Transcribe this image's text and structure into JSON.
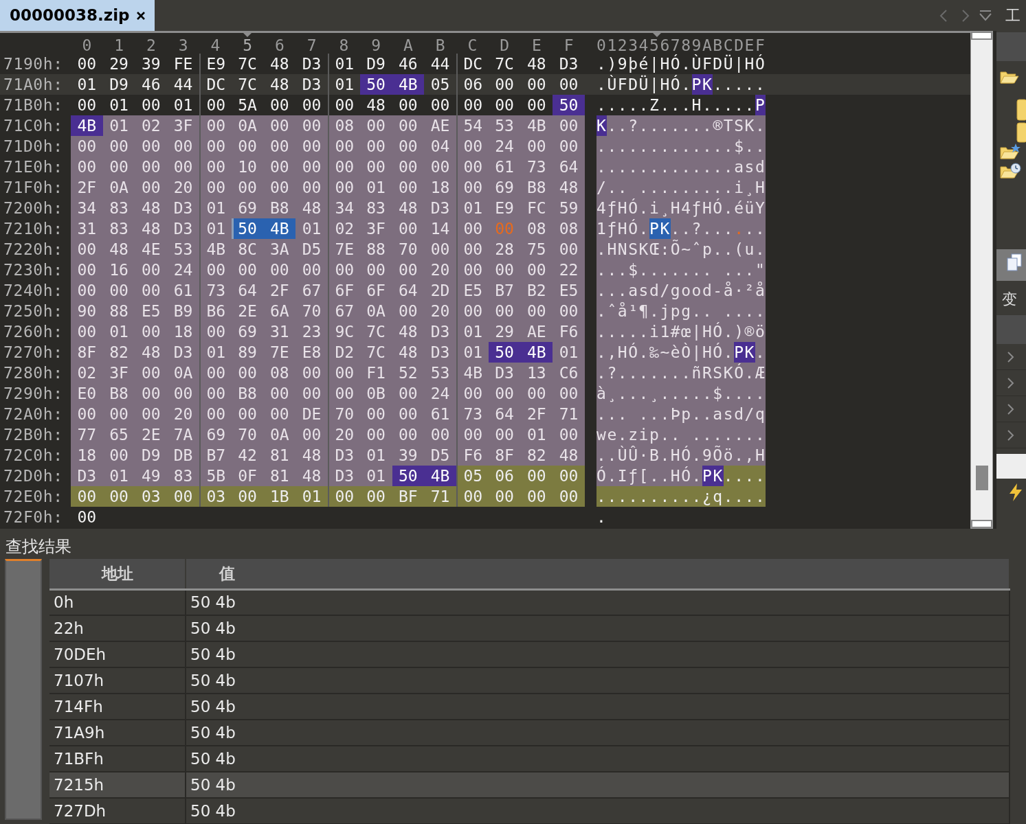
{
  "tabs": [
    {
      "label": "00000038.zip",
      "selected": true
    }
  ],
  "right_panel": {
    "title": "工",
    "section": "变"
  },
  "hex_view": {
    "columns": [
      {
        "label": "0",
        "selected": false
      },
      {
        "label": "1",
        "selected": false
      },
      {
        "label": "2",
        "selected": false
      },
      {
        "label": "3",
        "selected": false
      },
      {
        "label": "4",
        "selected": false
      },
      {
        "label": "5",
        "selected": true
      },
      {
        "label": "6",
        "selected": false
      },
      {
        "label": "7",
        "selected": false
      },
      {
        "label": "8",
        "selected": false
      },
      {
        "label": "9",
        "selected": false
      },
      {
        "label": "A",
        "selected": false
      },
      {
        "label": "B",
        "selected": false
      },
      {
        "label": "C",
        "selected": false
      },
      {
        "label": "D",
        "selected": false
      },
      {
        "label": "E",
        "selected": false
      },
      {
        "label": "F",
        "selected": false
      }
    ],
    "ascii_header": "0123456789ABCDEF",
    "rows": [
      {
        "offset": "7190h:",
        "highlighted": false,
        "hex": [
          {
            "kind": "plain",
            "bytes": [
              "00",
              "29",
              "39",
              "FE",
              "E9",
              "7C",
              "48",
              "D3",
              "01",
              "D9",
              "46",
              "44",
              "DC",
              "7C",
              "48",
              "D3"
            ]
          }
        ],
        "ascii": [
          {
            "kind": "plain",
            "text": ".)9þé|HÓ.ÙFDÜ|HÓ"
          }
        ]
      },
      {
        "offset": "71A0h:",
        "highlighted": true,
        "hex": [
          {
            "kind": "plain",
            "bytes": [
              "01",
              "D9",
              "46",
              "44",
              "DC",
              "7C",
              "48",
              "D3",
              "01"
            ]
          },
          {
            "kind": "match",
            "bytes": [
              "50",
              "4B"
            ]
          },
          {
            "kind": "plain",
            "bytes": [
              "05",
              "06",
              "00",
              "00",
              "00"
            ]
          }
        ],
        "ascii": [
          {
            "kind": "plain",
            "text": ".ÙFDÜ|HÓ."
          },
          {
            "kind": "match",
            "text": "PK"
          },
          {
            "kind": "plain",
            "text": "....."
          }
        ]
      },
      {
        "offset": "71B0h:",
        "highlighted": false,
        "hex": [
          {
            "kind": "plain",
            "bytes": [
              "00",
              "01",
              "00",
              "01",
              "00",
              "5A",
              "00",
              "00",
              "00",
              "48",
              "00",
              "00",
              "00",
              "00",
              "00"
            ]
          },
          {
            "kind": "match",
            "bytes": [
              "50"
            ]
          }
        ],
        "ascii": [
          {
            "kind": "plain",
            "text": ".....Z...H....."
          },
          {
            "kind": "match",
            "text": "P"
          }
        ]
      },
      {
        "offset": "71C0h:",
        "highlighted": false,
        "hex": [
          {
            "kind": "match",
            "bytes": [
              "4B"
            ]
          },
          {
            "kind": "region",
            "bytes": [
              "01",
              "02",
              "3F",
              "00",
              "0A",
              "00",
              "00",
              "08",
              "00",
              "00",
              "AE",
              "54",
              "53",
              "4B",
              "00"
            ]
          }
        ],
        "ascii": [
          {
            "kind": "match",
            "text": "K"
          },
          {
            "kind": "region",
            "text": "..?.......®TSK."
          }
        ]
      },
      {
        "offset": "71D0h:",
        "highlighted": false,
        "hex": [
          {
            "kind": "region",
            "bytes": [
              "00",
              "00",
              "00",
              "00",
              "00",
              "00",
              "00",
              "00",
              "00",
              "00",
              "00",
              "04",
              "00",
              "24",
              "00",
              "00"
            ]
          }
        ],
        "ascii": [
          {
            "kind": "region",
            "text": ".............$.."
          }
        ]
      },
      {
        "offset": "71E0h:",
        "highlighted": false,
        "hex": [
          {
            "kind": "region",
            "bytes": [
              "00",
              "00",
              "00",
              "00",
              "00",
              "10",
              "00",
              "00",
              "00",
              "00",
              "00",
              "00",
              "00",
              "61",
              "73",
              "64"
            ]
          }
        ],
        "ascii": [
          {
            "kind": "region",
            "text": ".............asd"
          }
        ]
      },
      {
        "offset": "71F0h:",
        "highlighted": false,
        "hex": [
          {
            "kind": "region",
            "bytes": [
              "2F",
              "0A",
              "00",
              "20",
              "00",
              "00",
              "00",
              "00",
              "00",
              "01",
              "00",
              "18",
              "00",
              "69",
              "B8",
              "48"
            ]
          }
        ],
        "ascii": [
          {
            "kind": "region",
            "text": "/.. .........i¸H"
          }
        ]
      },
      {
        "offset": "7200h:",
        "highlighted": false,
        "hex": [
          {
            "kind": "region",
            "bytes": [
              "34",
              "83",
              "48",
              "D3",
              "01",
              "69",
              "B8",
              "48",
              "34",
              "83",
              "48",
              "D3",
              "01",
              "E9",
              "FC",
              "59"
            ]
          }
        ],
        "ascii": [
          {
            "kind": "region",
            "text": "4ƒHÓ.i¸H4ƒHÓ.éüY"
          }
        ]
      },
      {
        "offset": "7210h:",
        "highlighted": false,
        "hex": [
          {
            "kind": "region",
            "bytes": [
              "31",
              "83",
              "48",
              "D3",
              "01"
            ]
          },
          {
            "kind": "selected",
            "bytes": [
              "50",
              "4B"
            ]
          },
          {
            "kind": "region",
            "bytes": [
              "01",
              "02",
              "3F",
              "00",
              "14",
              "00"
            ]
          },
          {
            "kind": "modified",
            "bytes": [
              "00"
            ]
          },
          {
            "kind": "region",
            "bytes": [
              "08",
              "08"
            ]
          }
        ],
        "ascii": [
          {
            "kind": "region",
            "text": "1ƒHÓ."
          },
          {
            "kind": "selected",
            "text": "PK"
          },
          {
            "kind": "region",
            "text": "..?..."
          },
          {
            "kind": "modified",
            "text": "."
          },
          {
            "kind": "region",
            "text": ".."
          }
        ]
      },
      {
        "offset": "7220h:",
        "highlighted": false,
        "hex": [
          {
            "kind": "region",
            "bytes": [
              "00",
              "48",
              "4E",
              "53",
              "4B",
              "8C",
              "3A",
              "D5",
              "7E",
              "88",
              "70",
              "00",
              "00",
              "28",
              "75",
              "00"
            ]
          }
        ],
        "ascii": [
          {
            "kind": "region",
            "text": ".HNSKŒ:Õ~ˆp..(u."
          }
        ]
      },
      {
        "offset": "7230h:",
        "highlighted": false,
        "hex": [
          {
            "kind": "region",
            "bytes": [
              "00",
              "16",
              "00",
              "24",
              "00",
              "00",
              "00",
              "00",
              "00",
              "00",
              "00",
              "20",
              "00",
              "00",
              "00",
              "22"
            ]
          }
        ],
        "ascii": [
          {
            "kind": "region",
            "text": "...$....... ...\""
          }
        ]
      },
      {
        "offset": "7240h:",
        "highlighted": false,
        "hex": [
          {
            "kind": "region",
            "bytes": [
              "00",
              "00",
              "00",
              "61",
              "73",
              "64",
              "2F",
              "67",
              "6F",
              "6F",
              "64",
              "2D",
              "E5",
              "B7",
              "B2",
              "E5"
            ]
          }
        ],
        "ascii": [
          {
            "kind": "region",
            "text": "...asd/good-å·²å"
          }
        ]
      },
      {
        "offset": "7250h:",
        "highlighted": false,
        "hex": [
          {
            "kind": "region",
            "bytes": [
              "90",
              "88",
              "E5",
              "B9",
              "B6",
              "2E",
              "6A",
              "70",
              "67",
              "0A",
              "00",
              "20",
              "00",
              "00",
              "00",
              "00"
            ]
          }
        ],
        "ascii": [
          {
            "kind": "region",
            "text": ".ˆå¹¶.jpg.. ...."
          }
        ]
      },
      {
        "offset": "7260h:",
        "highlighted": false,
        "hex": [
          {
            "kind": "region",
            "bytes": [
              "00",
              "01",
              "00",
              "18",
              "00",
              "69",
              "31",
              "23",
              "9C",
              "7C",
              "48",
              "D3",
              "01",
              "29",
              "AE",
              "F6"
            ]
          }
        ],
        "ascii": [
          {
            "kind": "region",
            "text": ".....i1#œ|HÓ.)®ö"
          }
        ]
      },
      {
        "offset": "7270h:",
        "highlighted": false,
        "hex": [
          {
            "kind": "region",
            "bytes": [
              "8F",
              "82",
              "48",
              "D3",
              "01",
              "89",
              "7E",
              "E8",
              "D2",
              "7C",
              "48",
              "D3",
              "01"
            ]
          },
          {
            "kind": "match",
            "bytes": [
              "50",
              "4B"
            ]
          },
          {
            "kind": "region",
            "bytes": [
              "01"
            ]
          }
        ],
        "ascii": [
          {
            "kind": "region",
            "text": ".‚HÓ.‰~èÒ|HÓ."
          },
          {
            "kind": "match",
            "text": "PK"
          },
          {
            "kind": "region",
            "text": "."
          }
        ]
      },
      {
        "offset": "7280h:",
        "highlighted": false,
        "hex": [
          {
            "kind": "region",
            "bytes": [
              "02",
              "3F",
              "00",
              "0A",
              "00",
              "00",
              "08",
              "00",
              "00",
              "F1",
              "52",
              "53",
              "4B",
              "D3",
              "13",
              "C6"
            ]
          }
        ],
        "ascii": [
          {
            "kind": "region",
            "text": ".?.......ñRSKÓ.Æ"
          }
        ]
      },
      {
        "offset": "7290h:",
        "highlighted": false,
        "hex": [
          {
            "kind": "region",
            "bytes": [
              "E0",
              "B8",
              "00",
              "00",
              "00",
              "B8",
              "00",
              "00",
              "00",
              "0B",
              "00",
              "24",
              "00",
              "00",
              "00",
              "00"
            ]
          }
        ],
        "ascii": [
          {
            "kind": "region",
            "text": "à¸...¸.....$...."
          }
        ]
      },
      {
        "offset": "72A0h:",
        "highlighted": false,
        "hex": [
          {
            "kind": "region",
            "bytes": [
              "00",
              "00",
              "00",
              "20",
              "00",
              "00",
              "00",
              "DE",
              "70",
              "00",
              "00",
              "61",
              "73",
              "64",
              "2F",
              "71"
            ]
          }
        ],
        "ascii": [
          {
            "kind": "region",
            "text": "... ...Þp..asd/q"
          }
        ]
      },
      {
        "offset": "72B0h:",
        "highlighted": false,
        "hex": [
          {
            "kind": "region",
            "bytes": [
              "77",
              "65",
              "2E",
              "7A",
              "69",
              "70",
              "0A",
              "00",
              "20",
              "00",
              "00",
              "00",
              "00",
              "00",
              "01",
              "00"
            ]
          }
        ],
        "ascii": [
          {
            "kind": "region",
            "text": "we.zip.. ......."
          }
        ]
      },
      {
        "offset": "72C0h:",
        "highlighted": false,
        "hex": [
          {
            "kind": "region",
            "bytes": [
              "18",
              "00",
              "D9",
              "DB",
              "B7",
              "42",
              "81",
              "48",
              "D3",
              "01",
              "39",
              "D5",
              "F6",
              "8F",
              "82",
              "48"
            ]
          }
        ],
        "ascii": [
          {
            "kind": "region",
            "text": "..ÙÛ·B.HÓ.9Õö.‚H"
          }
        ]
      },
      {
        "offset": "72D0h:",
        "highlighted": false,
        "hex": [
          {
            "kind": "region",
            "bytes": [
              "D3",
              "01",
              "49",
              "83",
              "5B",
              "0F",
              "81",
              "48",
              "D3",
              "01"
            ]
          },
          {
            "kind": "match",
            "bytes": [
              "50",
              "4B"
            ]
          },
          {
            "kind": "end",
            "bytes": [
              "05",
              "06",
              "00",
              "00"
            ]
          }
        ],
        "ascii": [
          {
            "kind": "region",
            "text": "Ó.Iƒ[..HÓ."
          },
          {
            "kind": "match",
            "text": "PK"
          },
          {
            "kind": "end",
            "text": "...."
          }
        ]
      },
      {
        "offset": "72E0h:",
        "highlighted": false,
        "hex": [
          {
            "kind": "end",
            "bytes": [
              "00",
              "00",
              "03",
              "00",
              "03",
              "00",
              "1B",
              "01",
              "00",
              "00",
              "BF",
              "71",
              "00",
              "00",
              "00",
              "00"
            ]
          }
        ],
        "ascii": [
          {
            "kind": "end",
            "text": "..........¿q...."
          }
        ]
      },
      {
        "offset": "72F0h:",
        "highlighted": false,
        "hex": [
          {
            "kind": "plain",
            "bytes": [
              "00"
            ]
          }
        ],
        "ascii": [
          {
            "kind": "plain",
            "text": "."
          }
        ]
      }
    ]
  },
  "find_results": {
    "title": "查找结果",
    "columns": [
      "地址",
      "值"
    ],
    "rows": [
      {
        "address": "0h",
        "value": "50 4b",
        "selected": false
      },
      {
        "address": "22h",
        "value": "50 4b",
        "selected": false
      },
      {
        "address": "70DEh",
        "value": "50 4b",
        "selected": false
      },
      {
        "address": "7107h",
        "value": "50 4b",
        "selected": false
      },
      {
        "address": "714Fh",
        "value": "50 4b",
        "selected": false
      },
      {
        "address": "71A9h",
        "value": "50 4b",
        "selected": false
      },
      {
        "address": "71BFh",
        "value": "50 4b",
        "selected": false
      },
      {
        "address": "7215h",
        "value": "50 4b",
        "selected": true
      },
      {
        "address": "727Dh",
        "value": "50 4b",
        "selected": false
      }
    ]
  }
}
